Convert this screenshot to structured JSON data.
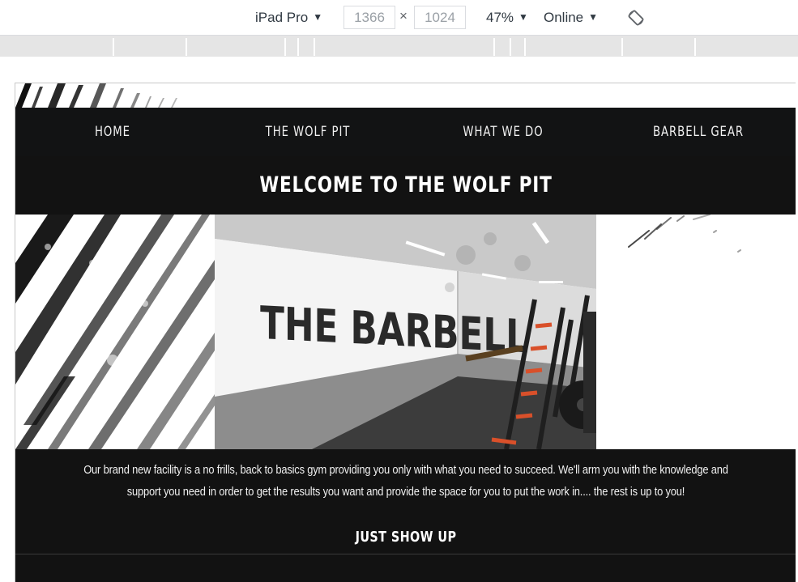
{
  "devtools": {
    "device": "iPad Pro",
    "width_value": "1366",
    "height_value": "1024",
    "times_symbol": "×",
    "zoom": "47%",
    "throttling": "Online",
    "dropdown_glyph": "▼"
  },
  "site": {
    "nav": {
      "items": [
        {
          "label": "HOME"
        },
        {
          "label": "THE WOLF PIT"
        },
        {
          "label": "WHAT WE DO"
        },
        {
          "label": "BARBELL GEAR"
        }
      ]
    },
    "welcome_title": "WELCOME TO THE WOLF PIT",
    "hero_wall_text": "THE BARBELL",
    "intro": "Our brand new facility is a no frills, back to basics gym providing you only with what you need to succeed. We'll arm you with the knowledge and support you need in order to get the results you want and provide the space for you to put the work in.... the rest is up to you!",
    "section_heading": "JUST SHOW UP"
  },
  "colors": {
    "site_background": "#121314",
    "site_text": "#f2f2f2",
    "devtools_text": "#303942",
    "media_bar": "#e5e5e5",
    "rack_accent": "#d9502a"
  },
  "icons": {
    "rotate": "rotate-device-icon",
    "dropdown": "dropdown-triangle-icon"
  }
}
